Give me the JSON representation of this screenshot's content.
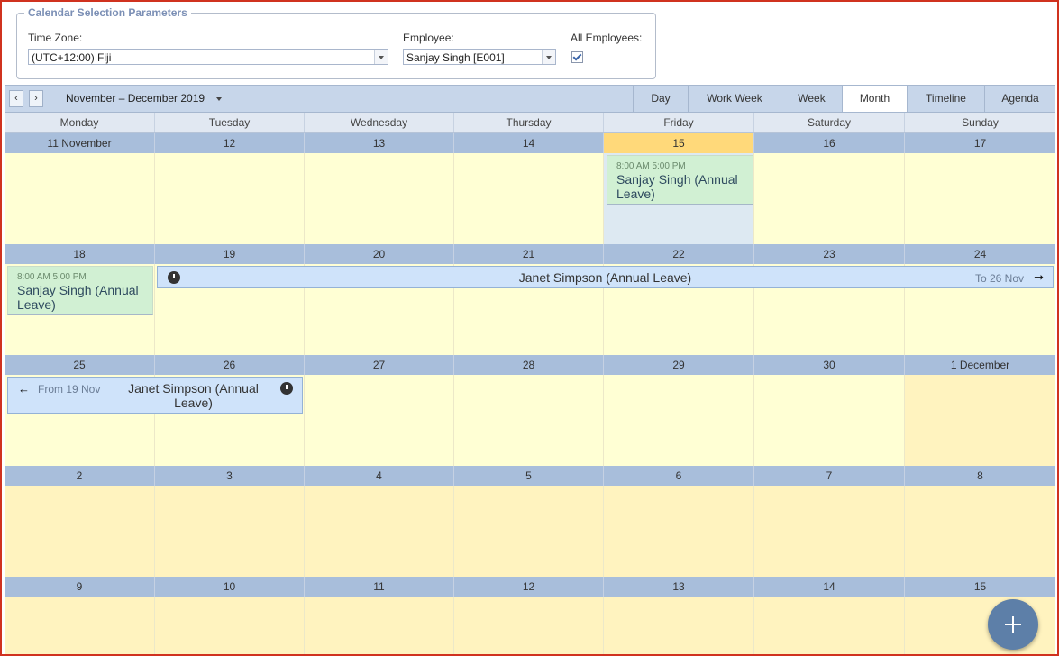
{
  "params": {
    "legend": "Calendar Selection Parameters",
    "timezone_label": "Time Zone:",
    "timezone_value": "(UTC+12:00) Fiji",
    "employee_label": "Employee:",
    "employee_value": "Sanjay Singh [E001]",
    "all_employees_label": "All Employees:",
    "all_employees_checked": true
  },
  "toolbar": {
    "prev": "‹",
    "next": "›",
    "period": "November – December 2019",
    "views": [
      "Day",
      "Work Week",
      "Week",
      "Month",
      "Timeline",
      "Agenda"
    ],
    "active_view": "Month"
  },
  "calendar": {
    "weekdays": [
      "Monday",
      "Tuesday",
      "Wednesday",
      "Thursday",
      "Friday",
      "Saturday",
      "Sunday"
    ],
    "weeks": [
      [
        "11 November",
        "12",
        "13",
        "14",
        "15",
        "16",
        "17"
      ],
      [
        "18",
        "19",
        "20",
        "21",
        "22",
        "23",
        "24"
      ],
      [
        "25",
        "26",
        "27",
        "28",
        "29",
        "30",
        "1 December"
      ],
      [
        "2",
        "3",
        "4",
        "5",
        "6",
        "7",
        "8"
      ],
      [
        "9",
        "10",
        "11",
        "12",
        "13",
        "14",
        "15"
      ]
    ],
    "today_label": "15"
  },
  "appointments": {
    "a1": {
      "time": "8:00 AM 5:00 PM",
      "title": "Sanjay Singh (Annual Leave)"
    },
    "a2": {
      "time": "8:00 AM 5:00 PM",
      "title": "Sanjay Singh (Annual Leave)"
    },
    "a3": {
      "title": "Janet Simpson (Annual Leave)",
      "continues": "To 26 Nov"
    },
    "a4": {
      "title": "Janet Simpson (Annual Leave)",
      "continued": "From 19 Nov"
    }
  },
  "colors": {
    "accent": "#5d7fa8",
    "today": "#ffd97a",
    "leave_green": "#d1f0d3",
    "leave_blue": "#cfe3fa"
  }
}
